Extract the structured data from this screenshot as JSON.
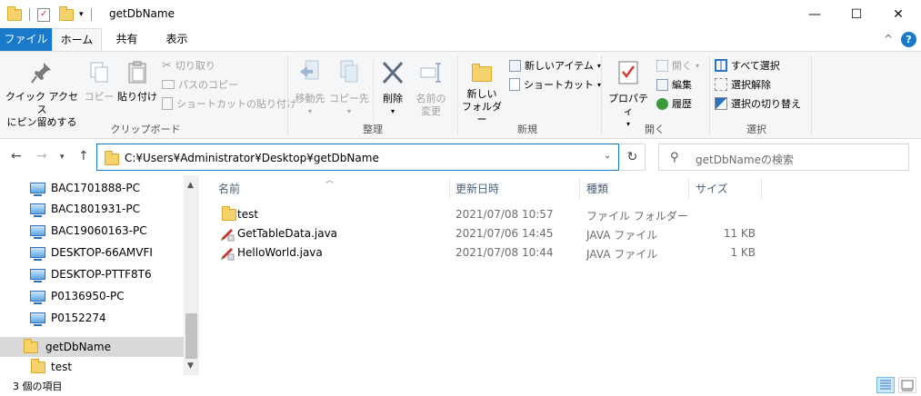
{
  "window": {
    "title": "getDbName",
    "minimize": "—",
    "maximize": "☐",
    "close": "✕"
  },
  "tabs": {
    "file": "ファイル",
    "home": "ホーム",
    "share": "共有",
    "view": "表示",
    "collapse": "^",
    "help": "?"
  },
  "ribbon": {
    "clipboard": {
      "label": "クリップボード",
      "pin_line1": "クイック アクセス",
      "pin_line2": "にピン留めする",
      "copy": "コピー",
      "paste": "貼り付け",
      "cut": "切り取り",
      "copy_path": "パスのコピー",
      "paste_shortcut": "ショートカットの貼り付け"
    },
    "organize": {
      "label": "整理",
      "move_to": "移動先",
      "copy_to": "コピー先",
      "delete": "削除",
      "rename_line1": "名前の",
      "rename_line2": "変更"
    },
    "new": {
      "label": "新規",
      "new_folder_line1": "新しい",
      "new_folder_line2": "フォルダー",
      "new_item": "新しいアイテム",
      "shortcut": "ショートカット"
    },
    "open": {
      "label": "開く",
      "properties": "プロパティ",
      "open": "開く",
      "edit": "編集",
      "history": "履歴"
    },
    "select": {
      "label": "選択",
      "select_all": "すべて選択",
      "select_none": "選択解除",
      "invert": "選択の切り替え"
    }
  },
  "address": {
    "path": "C:¥Users¥Administrator¥Desktop¥getDbName",
    "search_placeholder": "getDbNameの検索"
  },
  "nav": {
    "items": [
      {
        "label": "BAC1701888-PC"
      },
      {
        "label": "BAC1801931-PC"
      },
      {
        "label": "BAC19060163-PC"
      },
      {
        "label": "DESKTOP-66AMVFI"
      },
      {
        "label": "DESKTOP-PTTF8T6"
      },
      {
        "label": "P0136950-PC"
      },
      {
        "label": "P0152274"
      }
    ],
    "current_folder": "getDbName",
    "subfolder": "test"
  },
  "columns": {
    "name": "名前",
    "modified": "更新日時",
    "type": "種類",
    "size": "サイズ"
  },
  "files": [
    {
      "name": "test",
      "modified": "2021/07/08 10:57",
      "type": "ファイル フォルダー",
      "size": ""
    },
    {
      "name": "GetTableData.java",
      "modified": "2021/07/06 14:45",
      "type": "JAVA ファイル",
      "size": "11 KB"
    },
    {
      "name": "HelloWorld.java",
      "modified": "2021/07/08 10:44",
      "type": "JAVA ファイル",
      "size": "1 KB"
    }
  ],
  "status": {
    "item_count": "3 個の項目"
  }
}
